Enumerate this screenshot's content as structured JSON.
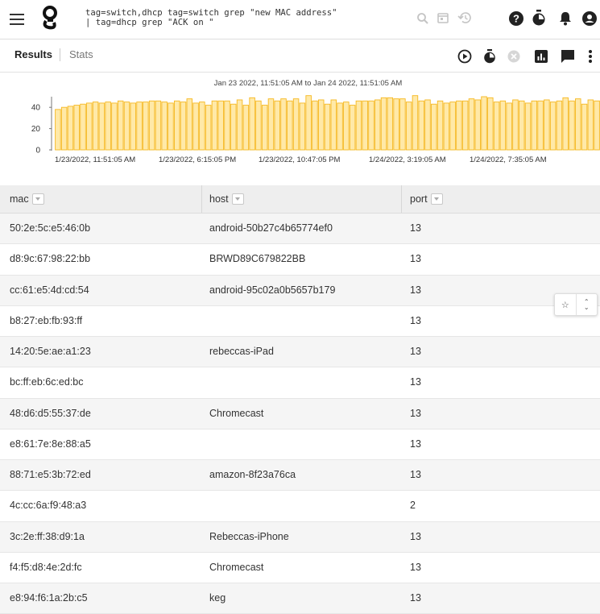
{
  "query": {
    "line1": "tag=switch,dhcp tag=switch grep \"new MAC address\"",
    "line2": "| tag=dhcp grep \"ACK on \""
  },
  "tabs": {
    "results": "Results",
    "stats": "Stats"
  },
  "icons": {
    "menu": "menu-icon",
    "logo": "logo-icon",
    "search": "search-icon",
    "calendar": "calendar-icon",
    "history": "history-icon",
    "help": "help-icon",
    "timer": "timer-icon",
    "bell": "bell-icon",
    "account": "account-icon",
    "play": "play-icon",
    "cancel": "cancel-icon",
    "chart": "chart-icon",
    "message": "message-icon",
    "more": "more-icon"
  },
  "colors": {
    "accent": "#f7c948",
    "bar_fill": "#ffe9a8",
    "bar_stroke": "#f6b820"
  },
  "chart_data": {
    "type": "bar",
    "title": "Jan 23 2022, 11:51:05 AM to Jan 24 2022, 11:51:05 AM",
    "yticks": [
      "40",
      "20",
      "0"
    ],
    "ylim": [
      0,
      50
    ],
    "xtick_labels": [
      "1/23/2022, 11:51:05 AM",
      "1/23/2022, 6:15:05 PM",
      "1/23/2022, 10:47:05 PM",
      "1/24/2022, 3:19:05 AM",
      "1/24/2022, 7:35:05 AM"
    ],
    "values": [
      38,
      40,
      41,
      42,
      43,
      44,
      45,
      44,
      45,
      44,
      46,
      45,
      44,
      45,
      45,
      46,
      46,
      45,
      44,
      46,
      45,
      48,
      44,
      45,
      42,
      46,
      46,
      46,
      43,
      47,
      42,
      49,
      46,
      42,
      48,
      46,
      48,
      46,
      48,
      44,
      51,
      46,
      47,
      43,
      47,
      44,
      45,
      42,
      46,
      46,
      46,
      47,
      49,
      49,
      48,
      48,
      45,
      51,
      46,
      47,
      43,
      46,
      44,
      45,
      46,
      46,
      48,
      47,
      50,
      49,
      45,
      46,
      44,
      47,
      46,
      44,
      46,
      46,
      47,
      45,
      46,
      49,
      46,
      48,
      43,
      47,
      46
    ]
  },
  "table": {
    "columns": [
      "mac",
      "host",
      "port"
    ],
    "rows": [
      [
        "50:2e:5c:e5:46:0b",
        "android-50b27c4b65774ef0",
        "13"
      ],
      [
        "d8:9c:67:98:22:bb",
        "BRWD89C679822BB",
        "13"
      ],
      [
        "cc:61:e5:4d:cd:54",
        "android-95c02a0b5657b179",
        "13"
      ],
      [
        "b8:27:eb:fb:93:ff",
        "",
        "13"
      ],
      [
        "14:20:5e:ae:a1:23",
        "rebeccas-iPad",
        "13"
      ],
      [
        "bc:ff:eb:6c:ed:bc",
        "",
        "13"
      ],
      [
        "48:d6:d5:55:37:de",
        "Chromecast",
        "13"
      ],
      [
        "e8:61:7e:8e:88:a5",
        "",
        "13"
      ],
      [
        "88:71:e5:3b:72:ed",
        "amazon-8f23a76ca",
        "13"
      ],
      [
        "4c:cc:6a:f9:48:a3",
        "",
        "2"
      ],
      [
        "3c:2e:ff:38:d9:1a",
        "Rebeccas-iPhone",
        "13"
      ],
      [
        "f4:f5:d8:4e:2d:fc",
        "Chromecast",
        "13"
      ],
      [
        "e8:94:f6:1a:2b:c5",
        "keg",
        "13"
      ]
    ]
  },
  "row_tools": {
    "star": "☆",
    "expand": "⌃⌄"
  }
}
